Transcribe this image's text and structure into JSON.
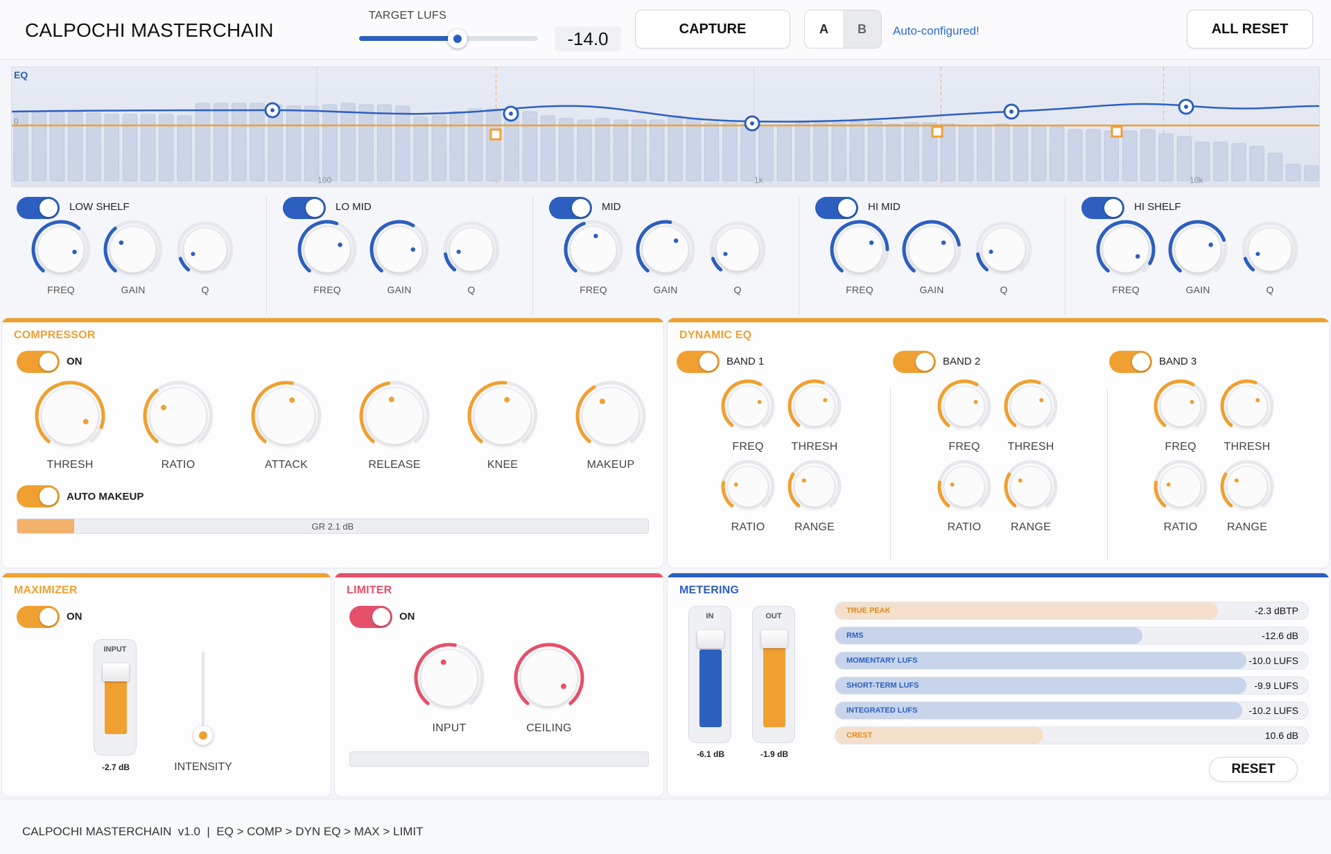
{
  "header": {
    "title": "CALPOCHI MASTERCHAIN",
    "target_lufs_label": "TARGET LUFS",
    "target_lufs_value": "-14.0",
    "target_lufs_fraction": 0.55,
    "capture_label": "CAPTURE",
    "ab_a": "A",
    "ab_b": "B",
    "auto_status": "Auto-configured!",
    "all_reset_label": "ALL RESET"
  },
  "eq": {
    "label": "EQ",
    "axis_labels": [
      "0",
      "100",
      "1k",
      "10k"
    ],
    "bands": [
      {
        "name": "LOW SHELF",
        "knobs": [
          "FREQ",
          "GAIN",
          "Q"
        ]
      },
      {
        "name": "LO MID",
        "knobs": [
          "FREQ",
          "GAIN",
          "Q"
        ]
      },
      {
        "name": "MID",
        "knobs": [
          "FREQ",
          "GAIN",
          "Q"
        ]
      },
      {
        "name": "HI MID",
        "knobs": [
          "FREQ",
          "GAIN",
          "Q"
        ]
      },
      {
        "name": "HI SHELF",
        "knobs": [
          "FREQ",
          "GAIN",
          "Q"
        ]
      }
    ]
  },
  "compressor": {
    "title": "COMPRESSOR",
    "on_label": "ON",
    "knobs": [
      "THRESH",
      "RATIO",
      "ATTACK",
      "RELEASE",
      "KNEE",
      "MAKEUP"
    ],
    "auto_makeup_label": "AUTO MAKEUP",
    "gr_label": "GR 2.1 dB",
    "gr_fraction": 0.09
  },
  "dynamic_eq": {
    "title": "DYNAMIC EQ",
    "bands": [
      {
        "name": "BAND 1",
        "knobs": [
          "FREQ",
          "THRESH",
          "RATIO",
          "RANGE"
        ]
      },
      {
        "name": "BAND 2",
        "knobs": [
          "FREQ",
          "THRESH",
          "RATIO",
          "RANGE"
        ]
      },
      {
        "name": "BAND 3",
        "knobs": [
          "FREQ",
          "THRESH",
          "RATIO",
          "RANGE"
        ]
      }
    ]
  },
  "maximizer": {
    "title": "MAXIMIZER",
    "on_label": "ON",
    "input_label": "INPUT",
    "input_value": "-2.7 dB",
    "intensity_label": "INTENSITY"
  },
  "limiter": {
    "title": "LIMITER",
    "on_label": "ON",
    "knobs": [
      "INPUT",
      "CEILING"
    ]
  },
  "metering": {
    "title": "METERING",
    "in_label": "IN",
    "in_value": "-6.1 dB",
    "out_label": "OUT",
    "out_value": "-1.9 dB",
    "meters": [
      {
        "name": "TRUE PEAK",
        "value": "-2.3 dBTP",
        "fraction": 0.81,
        "color": "orange"
      },
      {
        "name": "RMS",
        "value": "-12.6 dB",
        "fraction": 0.65,
        "color": "blue"
      },
      {
        "name": "MOMENTARY LUFS",
        "value": "-10.0 LUFS",
        "fraction": 0.87,
        "color": "blue"
      },
      {
        "name": "SHORT-TERM LUFS",
        "value": "-9.9 LUFS",
        "fraction": 0.87,
        "color": "blue"
      },
      {
        "name": "INTEGRATED LUFS",
        "value": "-10.2 LUFS",
        "fraction": 0.86,
        "color": "blue"
      },
      {
        "name": "CREST",
        "value": "10.6 dB",
        "fraction": 0.44,
        "color": "orange"
      }
    ],
    "reset_label": "RESET"
  },
  "footer": {
    "text": "CALPOCHI MASTERCHAIN  v1.0  |  EQ > COMP > DYN EQ > MAX > LIMIT"
  },
  "colors": {
    "blue": "#2c5fbf",
    "orange": "#f0a030",
    "red": "#e6506a"
  }
}
